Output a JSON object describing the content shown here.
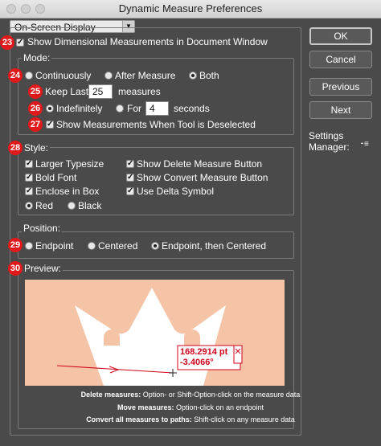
{
  "window": {
    "title": "Dynamic Measure Preferences"
  },
  "section_dropdown": {
    "value": "On-Screen Display"
  },
  "buttons": {
    "ok": "OK",
    "cancel": "Cancel",
    "previous": "Previous",
    "next": "Next"
  },
  "settings_manager": {
    "label_line1": "Settings",
    "label_line2": "Manager:",
    "icon": "menu-icon"
  },
  "badges": {
    "b23": "23",
    "b24": "24",
    "b25": "25",
    "b26": "26",
    "b27": "27",
    "b28": "28",
    "b29": "29",
    "b30": "30"
  },
  "show_dimensional": {
    "label": "Show Dimensional Measurements in Document Window",
    "checked": true
  },
  "mode": {
    "title": "Mode:",
    "continuously": "Continuously",
    "after_measure": "After Measure",
    "both": "Both",
    "selected": "Both",
    "keep_last_label": "Keep Last",
    "keep_last_value": "25",
    "measures_label": "measures",
    "indefinitely": "Indefinitely",
    "for_label": "For",
    "for_value": "4",
    "seconds_label": "seconds",
    "show_when_deselected": "Show Measurements When Tool is Deselected"
  },
  "style": {
    "title": "Style:",
    "larger_typesize": "Larger Typesize",
    "bold_font": "Bold Font",
    "enclose_in_box": "Enclose in Box",
    "show_delete_button": "Show Delete Measure Button",
    "show_convert_button": "Show Convert Measure Button",
    "use_delta_symbol": "Use Delta Symbol",
    "red": "Red",
    "black": "Black",
    "color_selected": "Red"
  },
  "position": {
    "title": "Position:",
    "endpoint": "Endpoint",
    "centered": "Centered",
    "endpoint_then_centered": "Endpoint, then Centered",
    "selected": "Endpoint, then Centered"
  },
  "preview": {
    "title": "Preview:",
    "measure_length": "168.2914 pt",
    "measure_angle": "-3.4066°",
    "colors": {
      "background": "#f5c3a6",
      "shape": "#ffffff",
      "measure": "#d0021b"
    }
  },
  "hints": [
    {
      "bold": "Delete measures:",
      "text": " Option- or Shift-Option-click on the measure data"
    },
    {
      "bold": "Move measures:",
      "text": " Option-click on an endpoint"
    },
    {
      "bold": "Convert all measures to paths:",
      "text": " Shift-click on any measure data"
    }
  ]
}
